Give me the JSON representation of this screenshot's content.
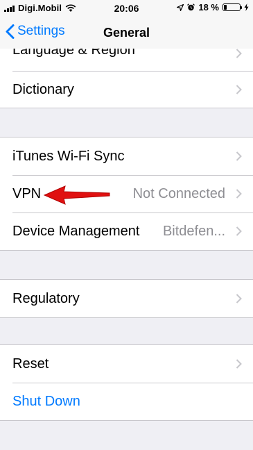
{
  "status_bar": {
    "carrier": "Digi.Mobil",
    "time": "20:06",
    "battery_percent_text": "18 %",
    "battery_level": 0.18,
    "icons": [
      "signal-icon",
      "wifi-icon",
      "location-icon",
      "alarm-icon",
      "battery-icon",
      "charging-icon"
    ]
  },
  "nav": {
    "back_label": "Settings",
    "title": "General"
  },
  "groups": [
    {
      "rows": [
        {
          "label": "Language & Region",
          "value": "",
          "chevron": true
        },
        {
          "label": "Dictionary",
          "value": "",
          "chevron": true
        }
      ]
    },
    {
      "rows": [
        {
          "label": "iTunes Wi-Fi Sync",
          "value": "",
          "chevron": true
        },
        {
          "label": "VPN",
          "value": "Not Connected",
          "chevron": true
        },
        {
          "label": "Device Management",
          "value": "Bitdefen...",
          "chevron": true
        }
      ]
    },
    {
      "rows": [
        {
          "label": "Regulatory",
          "value": "",
          "chevron": true
        }
      ]
    },
    {
      "rows": [
        {
          "label": "Reset",
          "value": "",
          "chevron": true
        },
        {
          "label": "Shut Down",
          "value": "",
          "chevron": false
        }
      ]
    }
  ],
  "colors": {
    "accent": "#007aff",
    "background": "#efeff4",
    "annotation_arrow": "#e01010"
  }
}
